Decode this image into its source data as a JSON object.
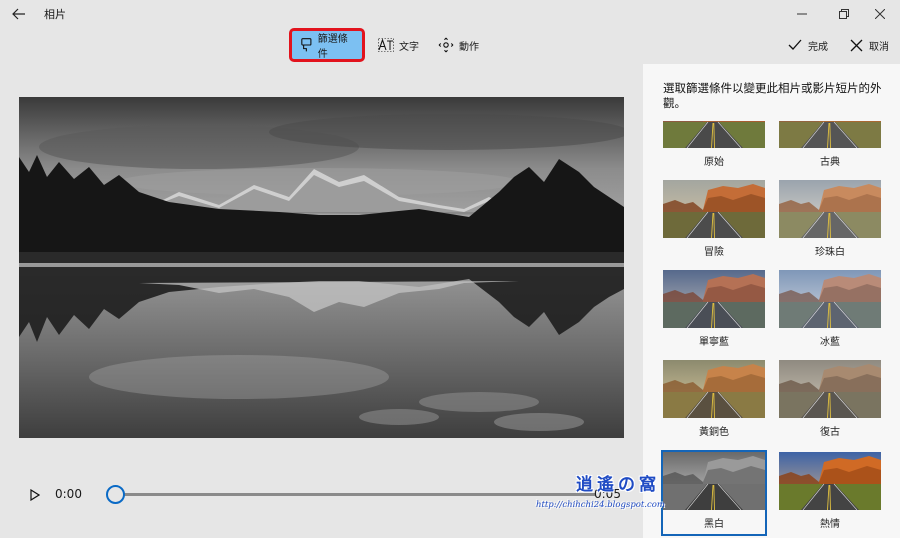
{
  "window": {
    "title": "相片"
  },
  "toolbar": {
    "filters_label": "篩選條件",
    "text_label": "文字",
    "motion_label": "動作",
    "done_label": "完成",
    "cancel_label": "取消"
  },
  "playback": {
    "current_time": "0:00",
    "end_time": "0:05",
    "progress": 0
  },
  "panel": {
    "description": "選取篩選條件以變更此相片或影片短片的外觀。",
    "filters": [
      {
        "label": "原始",
        "style": "original"
      },
      {
        "label": "古典",
        "style": "classic"
      },
      {
        "label": "冒險",
        "style": "adventure"
      },
      {
        "label": "珍珠白",
        "style": "pearl"
      },
      {
        "label": "單寧藍",
        "style": "denim"
      },
      {
        "label": "冰藍",
        "style": "ice"
      },
      {
        "label": "黃銅色",
        "style": "brass"
      },
      {
        "label": "復古",
        "style": "retro"
      },
      {
        "label": "黑白",
        "style": "bw"
      },
      {
        "label": "熱情",
        "style": "passion"
      }
    ],
    "selected_filter": "黑白"
  },
  "watermark": {
    "logo": "逍遙の窩",
    "url": "http://chihchi24.blogspot.com"
  },
  "colors": {
    "accent": "#0a6ac6",
    "active_tool_bg": "#7cc0f2",
    "highlight_border": "#e2131d"
  }
}
